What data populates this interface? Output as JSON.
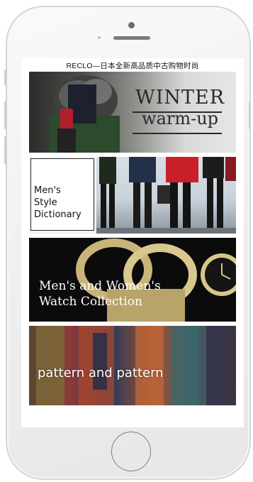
{
  "page": {
    "title": "RECLO—日本全新高品质中古购物时尚"
  },
  "banners": [
    {
      "id": "winter",
      "line1": "WINTER",
      "line2": "warm-up"
    },
    {
      "id": "dictionary",
      "lines": [
        "Men's",
        "Style",
        "Dictionary"
      ]
    },
    {
      "id": "watch",
      "lines": [
        "Men's and Women's",
        "Watch Collection"
      ]
    },
    {
      "id": "pattern",
      "text": "pattern and pattern"
    }
  ],
  "icons": [
    "front-camera-icon",
    "speaker-grille-icon",
    "home-button-icon"
  ],
  "colors": {
    "frame": "#f2f2f2",
    "screen_bg": "#ffffff",
    "watch_bg": "#0b0b0b",
    "text_dark": "#111111",
    "text_light": "#ffffff"
  }
}
